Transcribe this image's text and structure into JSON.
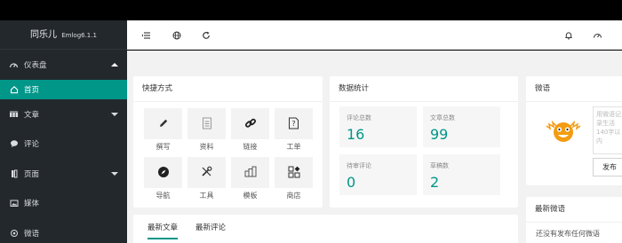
{
  "brand": {
    "name": "同乐儿",
    "version": "Emlog6.1.1"
  },
  "sidebar": {
    "items": [
      {
        "label": "仪表盘",
        "icon": "dashboard-icon"
      },
      {
        "label": "首页",
        "icon": "home-icon"
      },
      {
        "label": "文章",
        "icon": "article-icon"
      },
      {
        "label": "评论",
        "icon": "comment-icon"
      },
      {
        "label": "页面",
        "icon": "page-icon"
      },
      {
        "label": "媒体",
        "icon": "media-icon"
      },
      {
        "label": "微语",
        "icon": "twitter-icon"
      }
    ]
  },
  "header": {
    "icons": [
      "menu-toggle-icon",
      "globe-icon",
      "refresh-icon",
      "bell-icon",
      "theme-icon"
    ]
  },
  "quick": {
    "title": "快捷方式",
    "items": [
      {
        "label": "撰写",
        "icon": "pencil-icon"
      },
      {
        "label": "资料",
        "icon": "document-icon"
      },
      {
        "label": "链接",
        "icon": "link-icon"
      },
      {
        "label": "工单",
        "icon": "question-icon"
      },
      {
        "label": "导航",
        "icon": "compass-icon"
      },
      {
        "label": "工具",
        "icon": "tools-icon"
      },
      {
        "label": "模板",
        "icon": "template-icon"
      },
      {
        "label": "商店",
        "icon": "store-icon"
      }
    ]
  },
  "stats": {
    "title": "数据统计",
    "items": [
      {
        "label": "评论总数",
        "value": "16"
      },
      {
        "label": "文章总数",
        "value": "99"
      },
      {
        "label": "待审评论",
        "value": "0"
      },
      {
        "label": "草稿数",
        "value": "2"
      }
    ]
  },
  "microblog": {
    "title": "微语",
    "placeholder": "用微语记录生活140字以内",
    "post_label": "发布"
  },
  "latest_microblog": {
    "title": "最新微语",
    "empty": "还没有发布任何微语"
  },
  "tabs": [
    "最新文章",
    "最新评论"
  ],
  "colors": {
    "accent": "#009688",
    "sidebar": "#23282d"
  }
}
